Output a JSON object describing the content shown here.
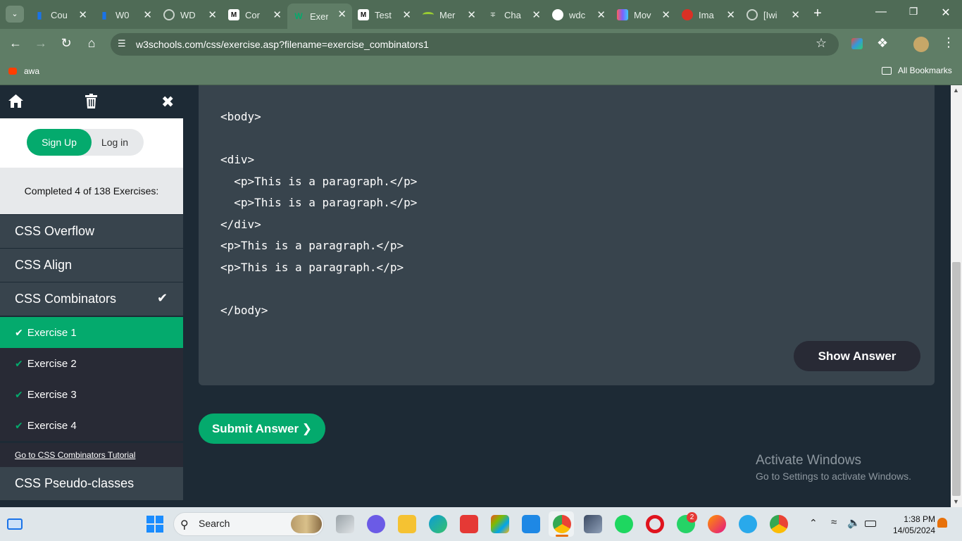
{
  "browser": {
    "tabs": [
      {
        "title": "Cou",
        "icon": "bar-chart-icon",
        "color": "#1a73e8"
      },
      {
        "title": "W0",
        "icon": "bar-chart-icon",
        "color": "#1a73e8"
      },
      {
        "title": "WD",
        "icon": "globe-icon",
        "color": "#c9d3cb"
      },
      {
        "title": "Cor",
        "icon": "m-logo-icon",
        "color": "#111111"
      },
      {
        "title": "Exer",
        "icon": "w3schools-icon",
        "color": "#04aa6d"
      },
      {
        "title": "Test",
        "icon": "m-logo-icon",
        "color": "#111111"
      },
      {
        "title": "Mer",
        "icon": "arc-icon",
        "color": "#9acd32"
      },
      {
        "title": "Cha",
        "icon": "chart-sparkle-icon",
        "color": "#c9d3cb"
      },
      {
        "title": "wdc",
        "icon": "github-icon",
        "color": "#ffffff"
      },
      {
        "title": "Mov",
        "icon": "colorful-logo-icon",
        "color": "#7b61ff"
      },
      {
        "title": "Ima",
        "icon": "image-logo-icon",
        "color": "#d93025"
      },
      {
        "title": "[Iwi",
        "icon": "globe-icon",
        "color": "#c9d3cb"
      }
    ],
    "active_tab": 4,
    "url": "w3schools.com/css/exercise.asp?filename=exercise_combinators1",
    "bookmark": "awa",
    "all_bookmarks": "All Bookmarks"
  },
  "sidebar": {
    "signup": "Sign Up",
    "login": "Log in",
    "progress": "Completed 4 of 138 Exercises:",
    "topics": [
      {
        "label": "CSS Overflow"
      },
      {
        "label": "CSS Align"
      },
      {
        "label": "CSS Combinators"
      }
    ],
    "exercises": [
      {
        "label": "Exercise 1"
      },
      {
        "label": "Exercise 2"
      },
      {
        "label": "Exercise 3"
      },
      {
        "label": "Exercise 4"
      }
    ],
    "tutorial_link": "Go to CSS Combinators Tutorial",
    "next_topic": "CSS Pseudo-classes"
  },
  "code": {
    "lines": [
      "<body>",
      "",
      "<div>",
      "  <p>This is a paragraph.</p>",
      "  <p>This is a paragraph.</p>",
      "</div>",
      "<p>This is a paragraph.</p>",
      "<p>This is a paragraph.</p>",
      "",
      "</body>"
    ]
  },
  "buttons": {
    "show_answer": "Show Answer",
    "submit": "Submit Answer ❯"
  },
  "watermark": {
    "title": "Activate Windows",
    "subtitle": "Go to Settings to activate Windows."
  },
  "taskbar": {
    "search": "Search",
    "time": "1:38 PM",
    "date": "14/05/2024",
    "whatsapp_badge": "2"
  },
  "colors": {
    "accent": "#04aa6d",
    "panel": "#38444d",
    "background": "#1d2a35",
    "chrome": "#5f7d66"
  }
}
